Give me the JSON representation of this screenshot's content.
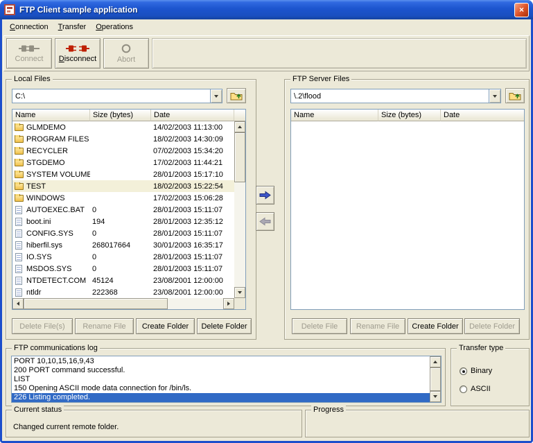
{
  "window": {
    "title": "FTP Client sample application",
    "close_glyph": "×"
  },
  "menu": {
    "items": [
      "Connection",
      "Transfer",
      "Operations"
    ]
  },
  "toolbar": {
    "connect_label": "Connect",
    "disconnect_label": "Disconnect",
    "abort_label": "Abort"
  },
  "local": {
    "group_label": "Local Files",
    "path": "C:\\",
    "columns": [
      "Name",
      "Size (bytes)",
      "Date"
    ],
    "selected_index": 5,
    "files": [
      {
        "name": "GLMDEMO",
        "type": "folder",
        "size": "",
        "date": "14/02/2003 11:13:00"
      },
      {
        "name": "PROGRAM FILES",
        "type": "folder",
        "size": "",
        "date": "18/02/2003 14:30:09"
      },
      {
        "name": "RECYCLER",
        "type": "folder",
        "size": "",
        "date": "07/02/2003 15:34:20"
      },
      {
        "name": "STGDEMO",
        "type": "folder",
        "size": "",
        "date": "17/02/2003 11:44:21"
      },
      {
        "name": "SYSTEM VOLUME ...",
        "type": "folder",
        "size": "",
        "date": "28/01/2003 15:17:10"
      },
      {
        "name": "TEST",
        "type": "folder",
        "size": "",
        "date": "18/02/2003 15:22:54"
      },
      {
        "name": "WINDOWS",
        "type": "folder",
        "size": "",
        "date": "17/02/2003 15:06:28"
      },
      {
        "name": "AUTOEXEC.BAT",
        "type": "file",
        "size": "0",
        "date": "28/01/2003 15:11:07"
      },
      {
        "name": "boot.ini",
        "type": "file",
        "size": "194",
        "date": "28/01/2003 12:35:12"
      },
      {
        "name": "CONFIG.SYS",
        "type": "file",
        "size": "0",
        "date": "28/01/2003 15:11:07"
      },
      {
        "name": "hiberfil.sys",
        "type": "file",
        "size": "268017664",
        "date": "30/01/2003 16:35:17"
      },
      {
        "name": "IO.SYS",
        "type": "file",
        "size": "0",
        "date": "28/01/2003 15:11:07"
      },
      {
        "name": "MSDOS.SYS",
        "type": "file",
        "size": "0",
        "date": "28/01/2003 15:11:07"
      },
      {
        "name": "NTDETECT.COM",
        "type": "file",
        "size": "45124",
        "date": "23/08/2001 12:00:00"
      },
      {
        "name": "ntldr",
        "type": "file",
        "size": "222368",
        "date": "23/08/2001 12:00:00"
      }
    ],
    "buttons": {
      "delete": "Delete File(s)",
      "rename": "Rename File",
      "create_folder": "Create Folder",
      "delete_folder": "Delete Folder"
    }
  },
  "remote": {
    "group_label": "FTP Server Files",
    "path": "\\.2\\flood",
    "columns": [
      "Name",
      "Size (bytes)",
      "Date"
    ],
    "files": [],
    "buttons": {
      "delete": "Delete File",
      "rename": "Rename File",
      "create_folder": "Create Folder",
      "delete_folder": "Delete Folder"
    }
  },
  "log": {
    "group_label": "FTP communications log",
    "selected_index": 4,
    "lines": [
      "PORT 10,10,15,16,9,43",
      "200 PORT command successful.",
      "LIST",
      "150 Opening ASCII mode data connection for /bin/ls.",
      "226 Listing completed."
    ]
  },
  "transfer_type": {
    "group_label": "Transfer type",
    "options": [
      "Binary",
      "ASCII"
    ],
    "selected": "Binary"
  },
  "status": {
    "group_label": "Current status",
    "text": "Changed current remote folder."
  },
  "progress": {
    "group_label": "Progress"
  },
  "colors": {
    "titlebar_blue": "#1C54CE",
    "selection_blue": "#316AC5",
    "row_highlight": "#F3F0D9",
    "accent_red": "#BF2104",
    "chrome": "#ECE9D8"
  }
}
